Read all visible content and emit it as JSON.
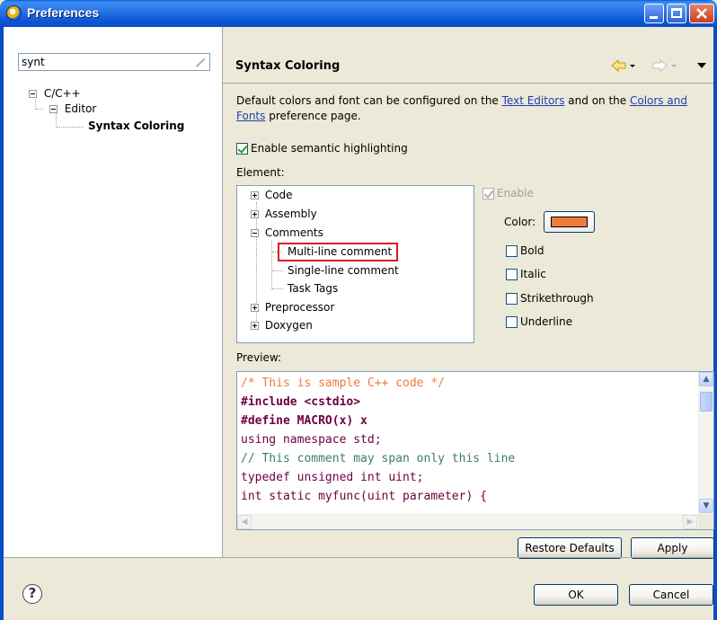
{
  "window": {
    "title": "Preferences"
  },
  "filter": {
    "value": "synt"
  },
  "left_tree": {
    "items": [
      {
        "label": "C/C++"
      },
      {
        "label": "Editor"
      },
      {
        "label": "Syntax Coloring"
      }
    ]
  },
  "page": {
    "title": "Syntax Coloring",
    "description_part1": "Default colors and font can be configured on the ",
    "link_text_editors": "Text Editors",
    "description_part2": " and on the ",
    "link_colors_fonts": "Colors and Fonts",
    "description_part3": " preference page.",
    "enable_semantic_label": "Enable semantic highlighting",
    "element_label": "Element:",
    "preview_label": "Preview:"
  },
  "element_tree": {
    "items": [
      {
        "label": "Code"
      },
      {
        "label": "Assembly"
      },
      {
        "label": "Comments"
      },
      {
        "label": "Multi-line comment"
      },
      {
        "label": "Single-line comment"
      },
      {
        "label": "Task Tags"
      },
      {
        "label": "Preprocessor"
      },
      {
        "label": "Doxygen"
      }
    ]
  },
  "options": {
    "enable_label": "Enable",
    "color_label": "Color:",
    "color_value": "#F07A3C",
    "bold_label": "Bold",
    "italic_label": "Italic",
    "strikethrough_label": "Strikethrough",
    "underline_label": "Underline"
  },
  "preview": {
    "lines": [
      "/* This is sample C++ code */",
      "#include <cstdio>",
      "#define MACRO(x) x",
      "using namespace std;",
      "// This comment may span only this line",
      "typedef unsigned int uint;",
      "int static myfunc(uint parameter) {"
    ]
  },
  "buttons": {
    "restore_defaults": "Restore Defaults",
    "apply": "Apply",
    "ok": "OK",
    "cancel": "Cancel"
  },
  "colors": {
    "titlebar": "#0A4CC8",
    "comment": "#F07A3C",
    "highlight_border": "#E0181E",
    "link": "#1F3FB0"
  }
}
